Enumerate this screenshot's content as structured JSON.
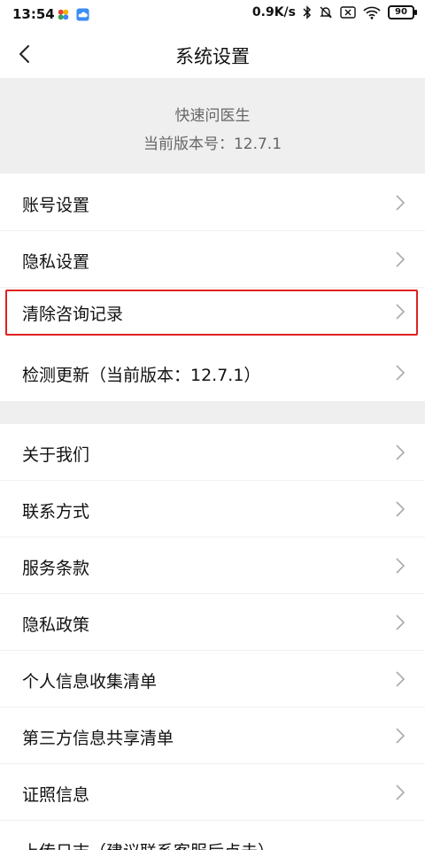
{
  "status_bar": {
    "time": "13:54",
    "network_speed": "0.9K/s",
    "battery": "90"
  },
  "nav": {
    "title": "系统设置"
  },
  "app_info": {
    "name": "快速问医生",
    "version": "当前版本号：12.7.1"
  },
  "group1": [
    {
      "label": "账号设置"
    },
    {
      "label": "隐私设置"
    },
    {
      "label": "清除咨询记录"
    },
    {
      "label": "检测更新（当前版本：12.7.1）"
    }
  ],
  "group2": [
    {
      "label": "关于我们"
    },
    {
      "label": "联系方式"
    },
    {
      "label": "服务条款"
    },
    {
      "label": "隐私政策"
    },
    {
      "label": "个人信息收集清单"
    },
    {
      "label": "第三方信息共享清单"
    },
    {
      "label": "证照信息"
    },
    {
      "label": "上传日志（建议联系客服后点击）"
    }
  ],
  "colors": {
    "highlight": "#e02020",
    "band": "#efefef"
  }
}
